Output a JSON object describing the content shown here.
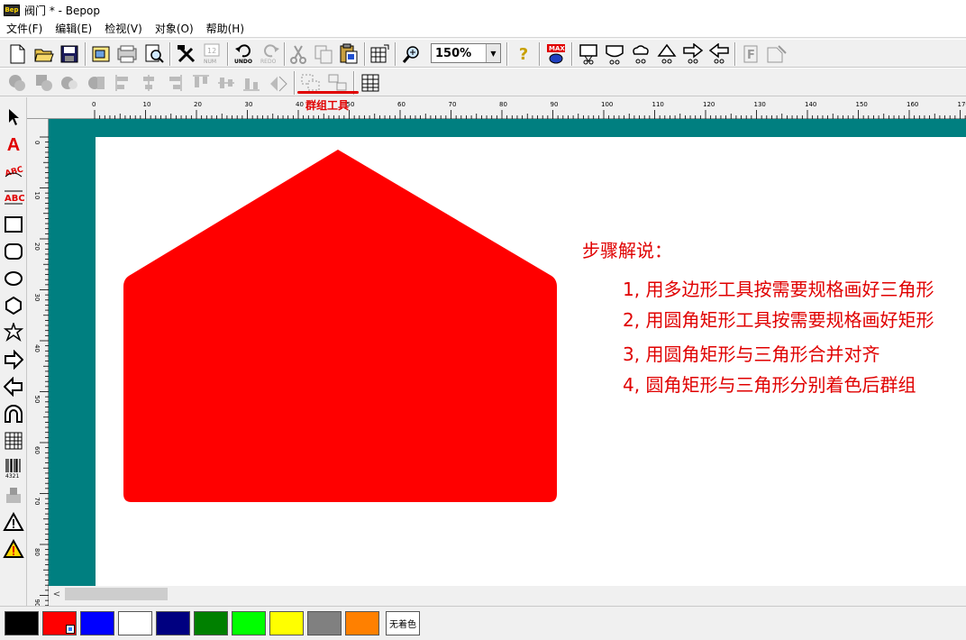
{
  "window": {
    "title": "阀门 * - Bepop",
    "logo_text": "Bepop"
  },
  "menu": [
    "文件(F)",
    "编辑(E)",
    "检视(V)",
    "对象(O)",
    "帮助(H)"
  ],
  "toolbar": {
    "zoom_value": "150%",
    "undo_label": "UNDO",
    "redo_label": "REDO",
    "num_label": "NUM",
    "max_label": "MAX",
    "group_tool_label": "群组工具"
  },
  "ruler": {
    "h_ticks": [
      "0",
      "10",
      "20",
      "30",
      "40",
      "50",
      "60",
      "70",
      "80",
      "90",
      "100",
      "110",
      "120",
      "130",
      "140",
      "150",
      "160",
      "170"
    ],
    "v_ticks": [
      "0",
      "10",
      "20",
      "30",
      "40",
      "50",
      "60",
      "70",
      "80",
      "90"
    ]
  },
  "notes": {
    "heading": "步骤解说：",
    "steps": [
      "1, 用多边形工具按需要规格画好三角形",
      "2, 用圆角矩形工具按需要规格画好矩形",
      "3, 用圆角矩形与三角形合并对齐",
      "4, 圆角矩形与三角形分别着色后群组"
    ]
  },
  "shape": {
    "fill": "#ff0000"
  },
  "colors": {
    "teal": "#007f80",
    "accent": "#e00000"
  },
  "palette": {
    "swatches": [
      "#000000",
      "#ff0000",
      "#0000ff",
      "#ffffff",
      "#000080",
      "#008000",
      "#00ff00",
      "#ffff00",
      "#808080",
      "#ff8000"
    ],
    "selected": "#ff0000",
    "none_label": "无着色"
  }
}
